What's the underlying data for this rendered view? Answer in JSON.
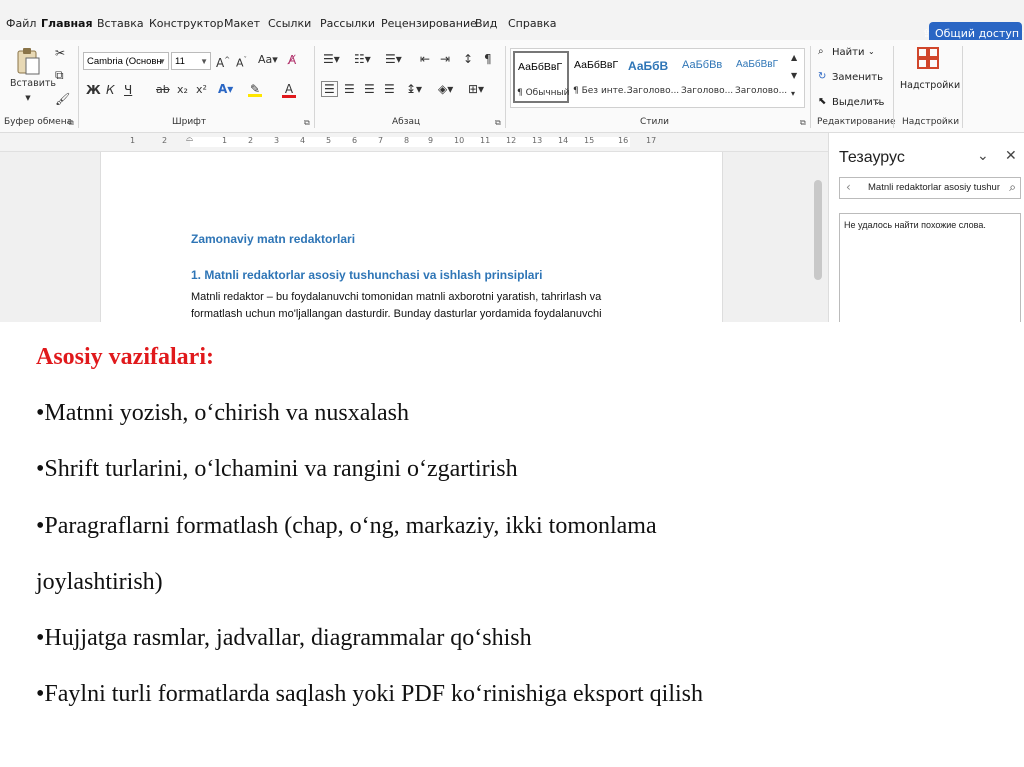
{
  "menu": {
    "tabs": [
      "Файл",
      "Главная",
      "Вставка",
      "Конструктор",
      "Макет",
      "Ссылки",
      "Рассылки",
      "Рецензирование",
      "Вид",
      "Справка"
    ],
    "share_label": "Общий доступ"
  },
  "ribbon": {
    "paste_label": "Вставить",
    "font_name": "Cambria (Основн",
    "font_size": "11",
    "format_buttons": [
      "Ж",
      "К",
      "Ч",
      "ab",
      "x₂",
      "x²"
    ],
    "styles": [
      {
        "sample": "АаБбВвГ",
        "name": "¶ Обычный"
      },
      {
        "sample": "АаБбВвГ",
        "name": "¶ Без инте..."
      },
      {
        "sample": "АаБбВ",
        "name": "Заголово..."
      },
      {
        "sample": "АаБбВв",
        "name": "Заголово..."
      },
      {
        "sample": "АаБбВвГ",
        "name": "Заголово..."
      }
    ],
    "find_label": "Найти",
    "replace_label": "Заменить",
    "select_label": "Выделить",
    "addins_label": "Надстройки",
    "group_labels": {
      "clipboard": "Буфер обмена",
      "font": "Шрифт",
      "paragraph": "Абзац",
      "styles": "Стили",
      "editing": "Редактирование",
      "addins": "Надстройки"
    }
  },
  "ruler": {
    "numbers": [
      "1",
      "2",
      "1",
      "2",
      "3",
      "4",
      "5",
      "6",
      "7",
      "8",
      "9",
      "10",
      "11",
      "12",
      "13",
      "14",
      "15",
      "16",
      "17"
    ]
  },
  "document": {
    "title": "Zamonaviy matn redaktorlari",
    "heading1": "1. Matnli redaktorlar asosiy tushunchasi va ishlash prinsiplari",
    "paragraph_lines": [
      "Matnli redaktor – bu foydalanuvchi tomonidan matnli axborotni yaratish, tahrirlash va",
      "formatlash uchun mo'ljallangan dasturdir. Bunday dasturlar yordamida foydalanuvchi"
    ]
  },
  "thesaurus": {
    "title": "Тезаурус",
    "search_value": "Matnli redaktorlar asosiy tushunc",
    "no_results": "Не удалось найти похожие слова."
  },
  "slide": {
    "heading": "Asosiy vazifalari:",
    "bullets": [
      "•Matnni yozish, o‘chirish va nusxalash",
      "•Shrift turlarini, o‘lchamini va rangini o‘zgartirish",
      "•Paragraflarni formatlash (chap, o‘ng, markaziy, ikki tomonlama",
      "joylashtirish)",
      "•Hujjatga rasmlar, jadvallar, diagrammalar qo‘shish",
      "•Faylni turli formatlarda saqlash yoki PDF ko‘rinishiga eksport qilish"
    ],
    "heading_color": "#e0191c"
  }
}
